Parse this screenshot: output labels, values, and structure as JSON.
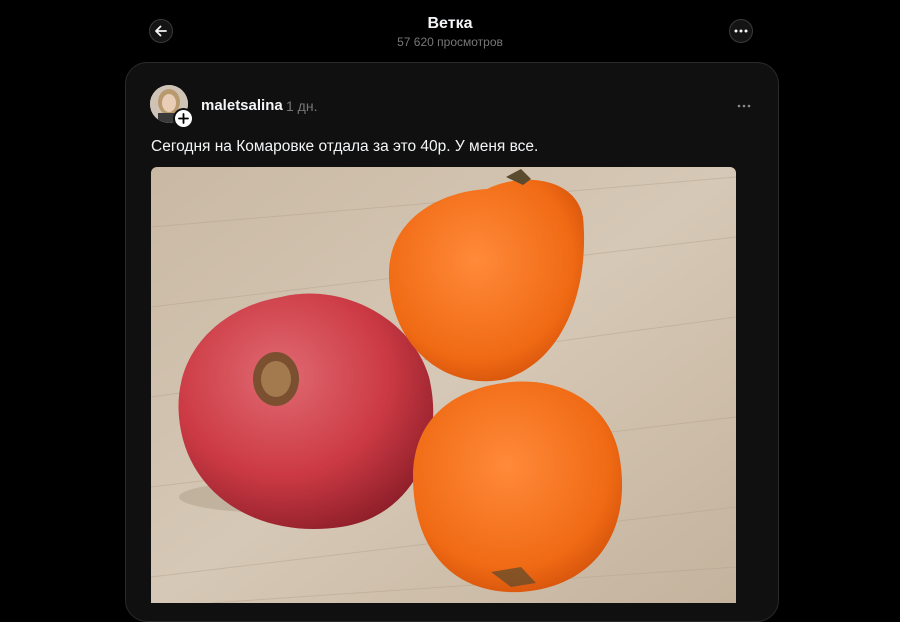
{
  "header": {
    "title": "Ветка",
    "views": "57 620 просмотров"
  },
  "icons": {
    "back": "arrow-left-icon",
    "more": "ellipsis-icon",
    "follow": "plus-icon"
  },
  "post": {
    "username": "maletsalina",
    "time": "1 дн.",
    "text": "Сегодня на Комаровке отдала за это 40р. У меня все.",
    "image_description_hidden": ""
  },
  "colors": {
    "background": "#000000",
    "card": "#101010",
    "text": "#f3f5f7",
    "muted": "#777777"
  }
}
